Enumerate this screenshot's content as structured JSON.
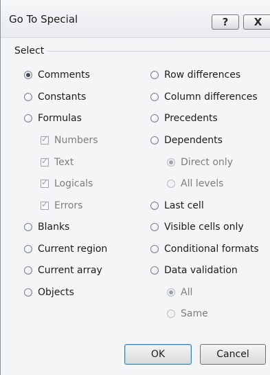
{
  "window": {
    "title": "Go To Special",
    "help_glyph": "?",
    "close_glyph": "X"
  },
  "group": {
    "label": "Select"
  },
  "left_options": [
    {
      "label": "Comments",
      "checked": true
    },
    {
      "label": "Constants",
      "checked": false
    },
    {
      "label": "Formulas",
      "checked": false
    },
    {
      "label": "Numbers",
      "checked": true,
      "type": "checkbox",
      "disabled": true
    },
    {
      "label": "Text",
      "checked": true,
      "type": "checkbox",
      "disabled": true
    },
    {
      "label": "Logicals",
      "checked": true,
      "type": "checkbox",
      "disabled": true
    },
    {
      "label": "Errors",
      "checked": true,
      "type": "checkbox",
      "disabled": true
    },
    {
      "label": "Blanks",
      "checked": false
    },
    {
      "label": "Current region",
      "checked": false
    },
    {
      "label": "Current array",
      "checked": false
    },
    {
      "label": "Objects",
      "checked": false
    }
  ],
  "right_options": [
    {
      "label": "Row differences",
      "checked": false
    },
    {
      "label": "Column differences",
      "checked": false
    },
    {
      "label": "Precedents",
      "checked": false
    },
    {
      "label": "Dependents",
      "checked": false
    },
    {
      "label": "Direct only",
      "checked": true,
      "disabled": true
    },
    {
      "label": "All levels",
      "checked": false,
      "disabled": true
    },
    {
      "label": "Last cell",
      "checked": false
    },
    {
      "label": "Visible cells only",
      "checked": false
    },
    {
      "label": "Conditional formats",
      "checked": false
    },
    {
      "label": "Data validation",
      "checked": false
    },
    {
      "label": "All",
      "checked": true,
      "disabled": true
    },
    {
      "label": "Same",
      "checked": false,
      "disabled": true
    }
  ],
  "buttons": {
    "ok": "OK",
    "cancel": "Cancel"
  }
}
